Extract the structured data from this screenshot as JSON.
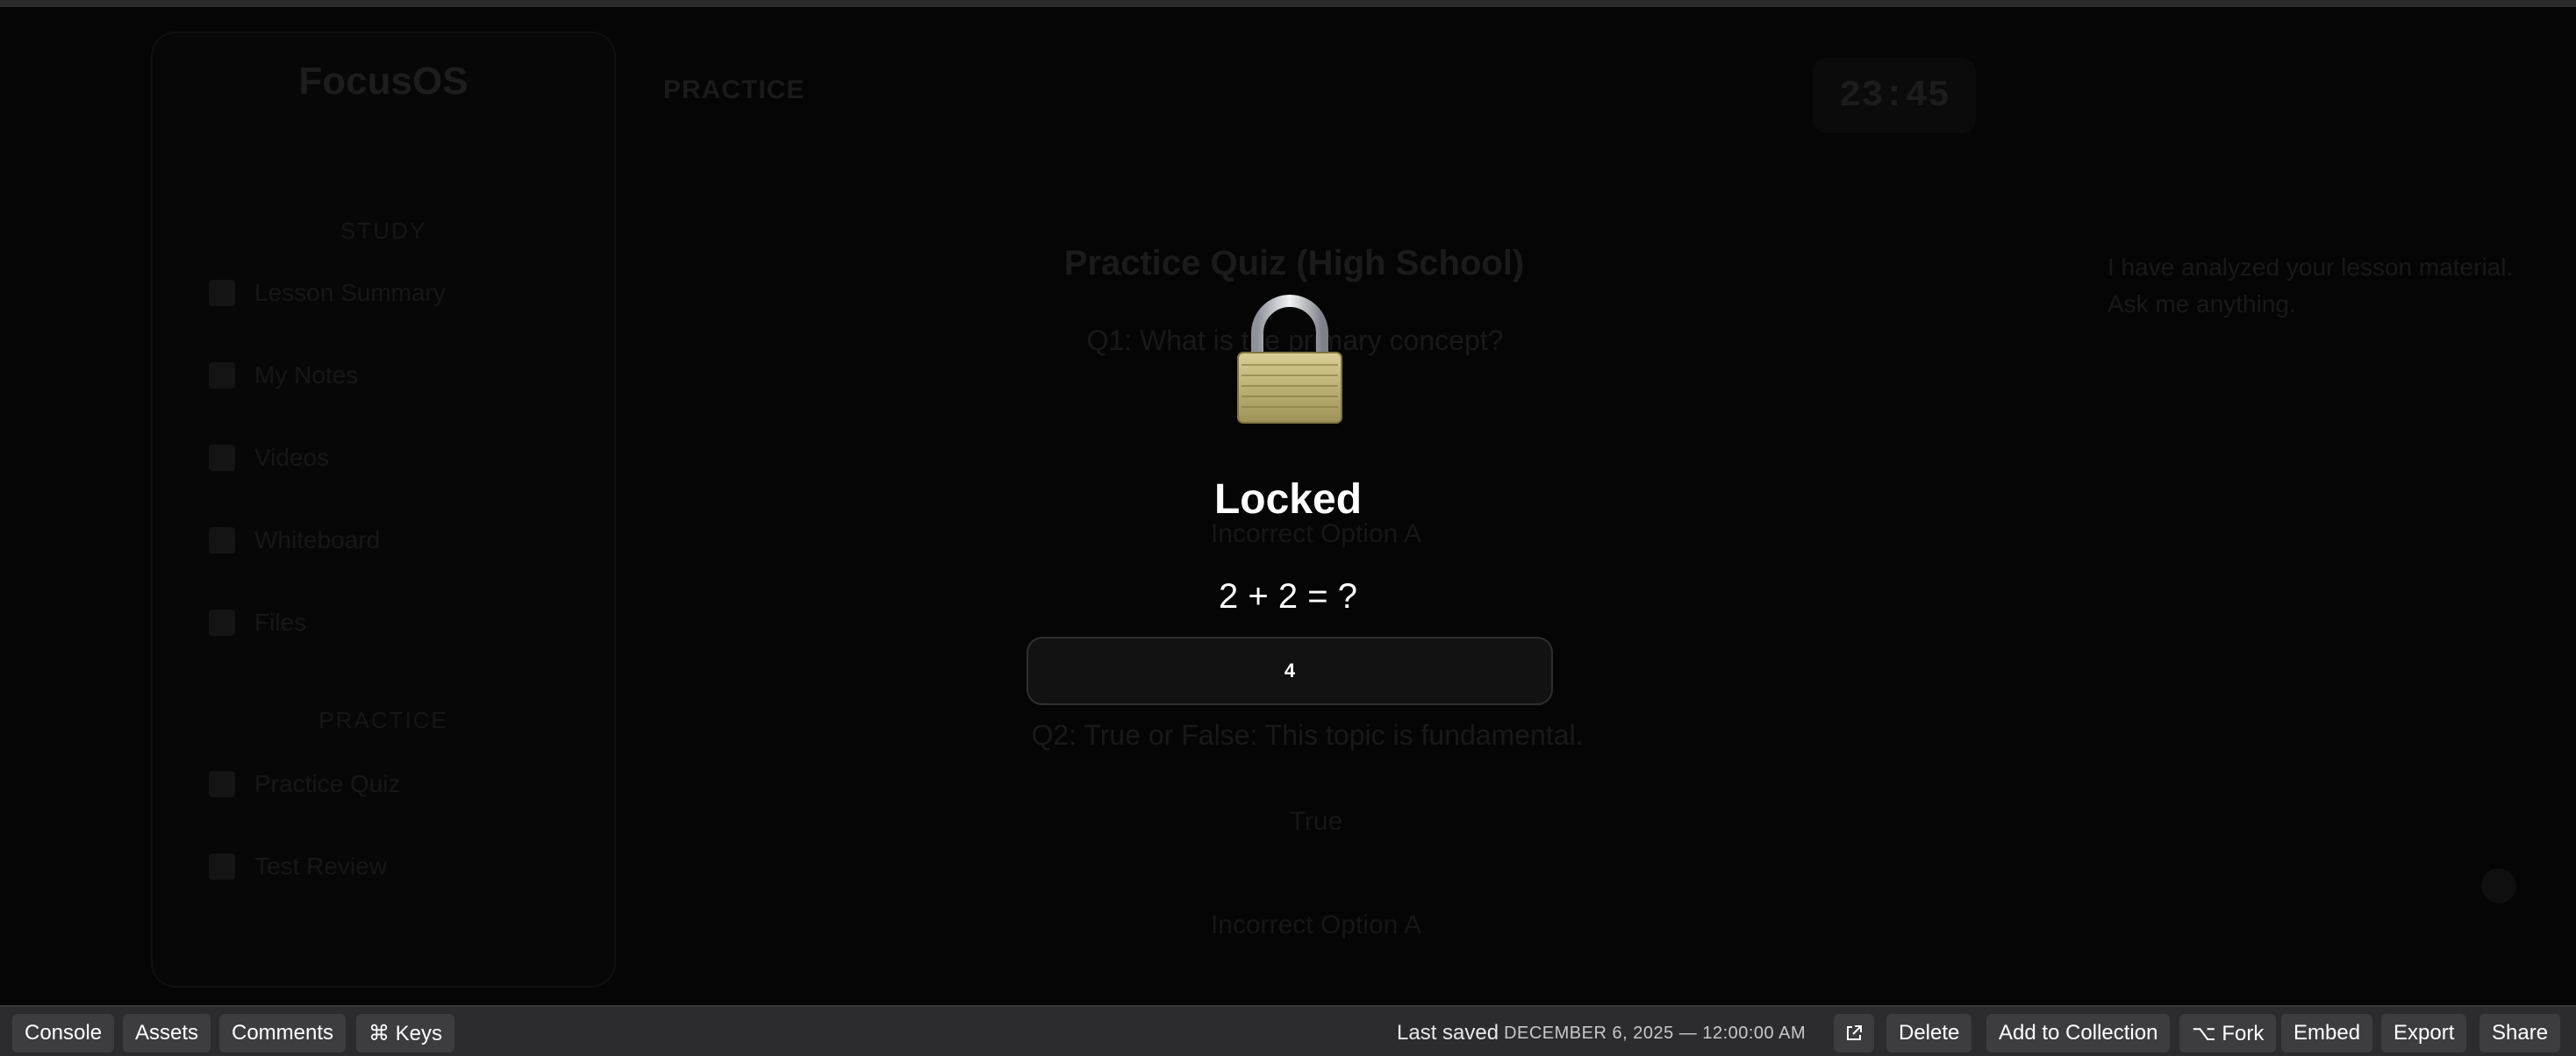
{
  "app": {
    "brand": "FocusOS",
    "header_title": "PRACTICE",
    "timer": "23:45",
    "sidebar": {
      "section_study": "STUDY",
      "items": [
        {
          "label": "Lesson Summary",
          "icon": "document-icon"
        },
        {
          "label": "My Notes",
          "icon": "notes-icon"
        },
        {
          "label": "Videos",
          "icon": "video-icon"
        },
        {
          "label": "Whiteboard",
          "icon": "whiteboard-icon"
        },
        {
          "label": "Files",
          "icon": "folder-icon"
        }
      ],
      "section_practice": "PRACTICE",
      "practice_items": [
        {
          "label": "Practice Quiz",
          "icon": "quiz-icon"
        },
        {
          "label": "Test Review",
          "icon": "checklist-icon"
        }
      ]
    },
    "quiz": {
      "title": "Practice Quiz (High School)",
      "q1": "Q1: What is the primary concept?",
      "q1_option": "Incorrect Option A",
      "q2": "Q2: True or False: This topic is fundamental.",
      "q2_option_true": "True",
      "q2_option_incorrect": "Incorrect Option A"
    },
    "assistant": {
      "message": "I have analyzed your lesson material. Ask me anything."
    }
  },
  "lock": {
    "icon": "padlock-icon",
    "title": "Locked",
    "question": "2 + 2 = ?",
    "answer_value": "4"
  },
  "toolbar": {
    "console": "Console",
    "assets": "Assets",
    "comments": "Comments",
    "keys": "⌘ Keys",
    "last_saved_label": "Last saved",
    "last_saved_time": "DECEMBER 6, 2025 — 12:00:00 AM",
    "open_external_icon": "external-link-icon",
    "delete": "Delete",
    "add_to_collection": "Add to Collection",
    "fork": "⌥ Fork",
    "embed": "Embed",
    "export": "Export",
    "share": "Share"
  }
}
